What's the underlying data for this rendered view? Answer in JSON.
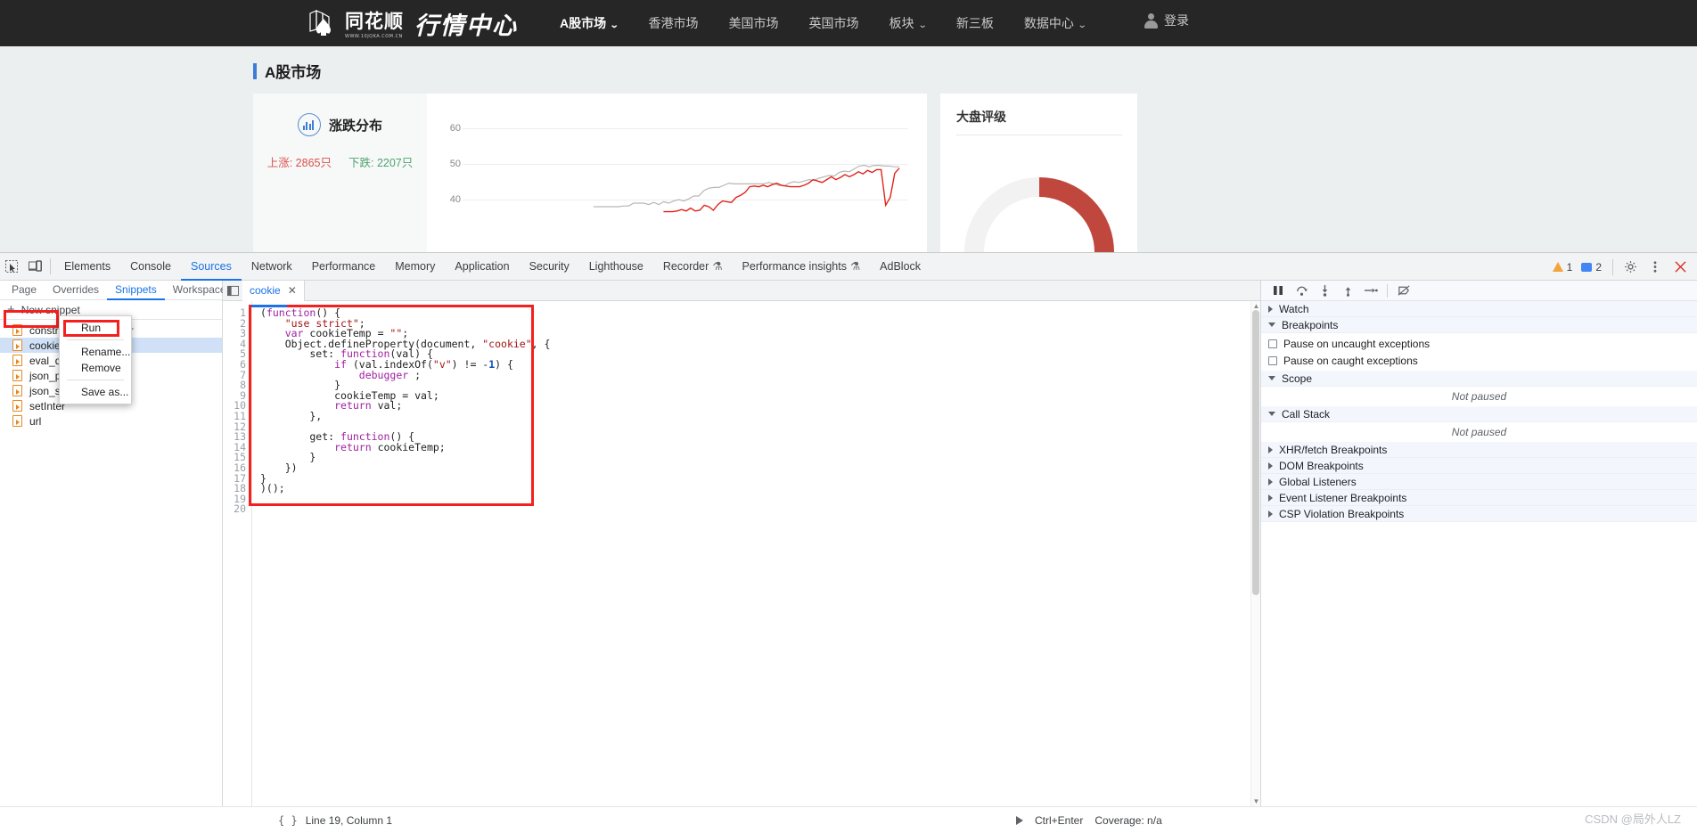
{
  "site": {
    "logo": {
      "brand": "同花顺",
      "domain": "WWW.10JQKA.COM.CN",
      "product": "行情中心",
      "icon": "logo-icon"
    },
    "nav": [
      {
        "label": "A股市场",
        "active": true,
        "caret": true
      },
      {
        "label": "香港市场",
        "active": false,
        "caret": false
      },
      {
        "label": "美国市场",
        "active": false,
        "caret": false
      },
      {
        "label": "英国市场",
        "active": false,
        "caret": false
      },
      {
        "label": "板块",
        "active": false,
        "caret": true
      },
      {
        "label": "新三板",
        "active": false,
        "caret": false
      },
      {
        "label": "数据中心",
        "active": false,
        "caret": true
      }
    ],
    "login": {
      "label": "登录",
      "icon": "user-avatar-icon"
    },
    "page_title": "A股市场",
    "dist_card": {
      "icon": "bar-chart-icon",
      "title": "涨跌分布",
      "up_label": "上涨: 2865只",
      "down_label": "下跌: 2207只",
      "up_color": "#d9534f",
      "down_color": "#4fa36e"
    },
    "rating_card": {
      "title": "大盘评级",
      "gauge_color": "#c0473e",
      "gauge_track": "#f2f2f2"
    }
  },
  "chart_data": {
    "type": "line",
    "title": "",
    "xlabel": "",
    "ylabel": "",
    "ylim": [
      35,
      62
    ],
    "yticks": [
      40,
      50,
      60
    ],
    "grid": true,
    "legend": "none",
    "series": [
      {
        "name": "grey",
        "color": "#b6b6b6",
        "values": [
          38,
          38,
          38,
          38,
          38,
          38,
          38.2,
          38.2,
          39,
          39,
          39,
          38.6,
          39.2,
          38.6,
          39.4,
          39,
          39.6,
          40,
          39.6,
          40.2,
          41,
          41,
          42.5,
          43.2,
          43.4,
          43.4,
          44,
          44.6,
          44.4,
          44.4,
          44.4,
          44.4,
          44.4,
          44.4,
          44.4,
          44.8,
          44.4,
          44,
          43.8,
          44.6,
          45,
          44.8,
          45.2,
          45.6,
          45.4,
          46,
          46.4,
          46.8,
          46.6,
          47.6,
          48,
          47.8,
          48.6,
          49.4,
          49.6,
          49.2,
          49.6,
          49.6,
          49.4,
          49.4,
          49.2,
          49.2
        ]
      },
      {
        "name": "red",
        "color": "#e2231a",
        "values": [
          36.6,
          36.6,
          36.6,
          36.8,
          37.2,
          36.8,
          37.6,
          36.8,
          37,
          38.4,
          38,
          37,
          38.6,
          39.6,
          39.4,
          39.2,
          40.6,
          41.2,
          42,
          43.6,
          43.8,
          43.6,
          44,
          43.6,
          44.2,
          44.6,
          44,
          43.8,
          43.6,
          43.6,
          43.6,
          44,
          44.6,
          45.6,
          45.2,
          44.8,
          45.6,
          46.4,
          45.6,
          46.2,
          47,
          46.4,
          47,
          47.8,
          47.2,
          48.2,
          47.6,
          48.4,
          48.4,
          38.4,
          40.6,
          47.4,
          48.8
        ]
      }
    ]
  },
  "devtools": {
    "left_icons": [
      {
        "name": "inspect-element-icon"
      },
      {
        "name": "device-toolbar-icon"
      }
    ],
    "tabs": [
      {
        "label": "Elements",
        "selected": false,
        "badge": ""
      },
      {
        "label": "Console",
        "selected": false,
        "badge": ""
      },
      {
        "label": "Sources",
        "selected": true,
        "badge": ""
      },
      {
        "label": "Network",
        "selected": false,
        "badge": ""
      },
      {
        "label": "Performance",
        "selected": false,
        "badge": ""
      },
      {
        "label": "Memory",
        "selected": false,
        "badge": ""
      },
      {
        "label": "Application",
        "selected": false,
        "badge": ""
      },
      {
        "label": "Security",
        "selected": false,
        "badge": ""
      },
      {
        "label": "Lighthouse",
        "selected": false,
        "badge": ""
      },
      {
        "label": "Recorder",
        "selected": false,
        "badge": "flask-icon"
      },
      {
        "label": "Performance insights",
        "selected": false,
        "badge": "flask-icon"
      },
      {
        "label": "AdBlock",
        "selected": false,
        "badge": ""
      }
    ],
    "warning_count": "1",
    "message_count": "2",
    "settings_icon": "gear-icon",
    "more_icon": "kebab-menu-icon",
    "close_icon": "close-icon",
    "navigator": {
      "tabs": [
        {
          "label": "Page",
          "selected": false
        },
        {
          "label": "Overrides",
          "selected": false
        },
        {
          "label": "Snippets",
          "selected": true
        },
        {
          "label": "Workspace",
          "selected": false
        }
      ],
      "more_tabs_icon": "chevron-double-right-icon",
      "more_options_icon": "kebab-menu-icon",
      "new_snippet": "New snippet",
      "snippets": [
        {
          "label": "constructor_debugger",
          "selected": false
        },
        {
          "label": "cookie",
          "selected": true
        },
        {
          "label": "eval_de",
          "selected": false
        },
        {
          "label": "json_pa",
          "selected": false
        },
        {
          "label": "json_str",
          "selected": false
        },
        {
          "label": "setInter",
          "selected": false
        },
        {
          "label": "url",
          "selected": false
        }
      ]
    },
    "context_menu": {
      "items": [
        {
          "label": "Run",
          "highlighted": true
        },
        {
          "label": "Rename...",
          "highlighted": false
        },
        {
          "label": "Remove",
          "highlighted": false
        },
        {
          "label": "Save as...",
          "highlighted": false
        }
      ]
    },
    "editor": {
      "panel_toggle_icon": "show-navigator-icon",
      "tab_label": "cookie",
      "tab_close_icon": "close-icon",
      "line_count": 20,
      "lines": [
        "(function() {",
        "    \"use strict\";",
        "    var cookieTemp = \"\";",
        "    Object.defineProperty(document, \"cookie\", {",
        "        set: function(val) {",
        "            if (val.indexOf(\"v\") != -1) {",
        "                debugger ;",
        "            }",
        "            cookieTemp = val;",
        "            return val;",
        "        },",
        "",
        "        get: function() {",
        "            return cookieTemp;",
        "        }",
        "    })",
        "}",
        ")();",
        "",
        ""
      ]
    },
    "debugger": {
      "toolbar": [
        {
          "name": "pause-resume-icon"
        },
        {
          "name": "step-over-icon"
        },
        {
          "name": "step-into-icon"
        },
        {
          "name": "step-out-icon"
        },
        {
          "name": "step-icon"
        },
        {
          "name": "deactivate-breakpoints-icon"
        }
      ],
      "sections": [
        {
          "label": "Watch",
          "expanded": false
        },
        {
          "label": "Breakpoints",
          "expanded": true
        },
        {
          "label": "Scope",
          "expanded": true,
          "empty_text": "Not paused"
        },
        {
          "label": "Call Stack",
          "expanded": true,
          "empty_text": "Not paused"
        },
        {
          "label": "XHR/fetch Breakpoints",
          "expanded": false
        },
        {
          "label": "DOM Breakpoints",
          "expanded": false
        },
        {
          "label": "Global Listeners",
          "expanded": false
        },
        {
          "label": "Event Listener Breakpoints",
          "expanded": false
        },
        {
          "label": "CSP Violation Breakpoints",
          "expanded": false
        }
      ],
      "checkboxes": [
        {
          "label": "Pause on uncaught exceptions",
          "checked": false
        },
        {
          "label": "Pause on caught exceptions",
          "checked": false
        }
      ]
    },
    "status_bar": {
      "format_icon": "pretty-print-icon",
      "position": "Line 19, Column 1",
      "run_icon": "run-snippet-icon",
      "shortcut": "Ctrl+Enter",
      "coverage": "Coverage: n/a"
    }
  },
  "watermark": "CSDN @局外人LZ"
}
